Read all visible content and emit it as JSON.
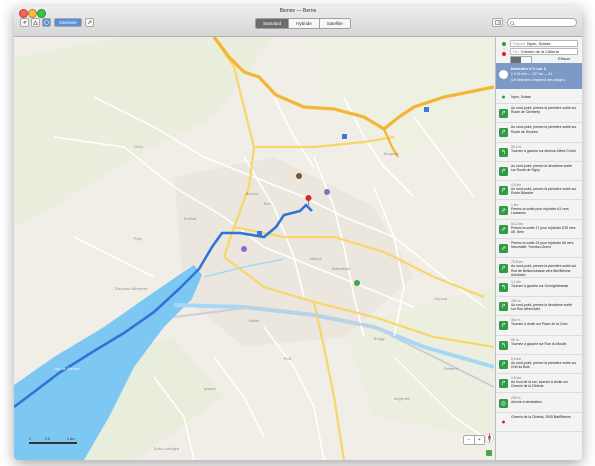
{
  "window": {
    "title": "Bienne — Berne"
  },
  "toolbar": {
    "itinerary_label": "Itinéraire",
    "map_modes": [
      "Standard",
      "Hybride",
      "Satellite"
    ],
    "selected_mode": "Standard"
  },
  "route": {
    "depart_label": "Départ",
    "depart_value": "Nyon, Suisse",
    "arrival_label": "Fin",
    "arrival_value": "Chemin de la Cibleria",
    "clear_label": "Effacer",
    "summary_title": "Itinéraire n°1 sur 2",
    "summary_detail": "1 h 49 min — 137 km — A1",
    "summary_note": "Cet itinéraire comprend des péages."
  },
  "steps": [
    {
      "icon": "pin-icon",
      "distance": "",
      "text": "Nyon, Suisse"
    },
    {
      "icon": "turn-right-icon",
      "distance": "",
      "text": "Au rond-point, prenez la première sortie sur Route de Clémenty"
    },
    {
      "icon": "turn-right-icon",
      "distance": "",
      "text": "Au rond-point, prenez la première sortie sur Route de Divonne"
    },
    {
      "icon": "turn-left-icon",
      "distance": "50,1 m",
      "text": "Tournez à gauche sur Avenue Alfred Cortot"
    },
    {
      "icon": "turn-right-icon",
      "distance": "",
      "text": "Au rond-point, prenez la deuxième sortie sur Route de Signy"
    },
    {
      "icon": "turn-right-icon",
      "distance": "0,6 km",
      "text": "Au rond-point, prenez la première sortie sur Route Blanche"
    },
    {
      "icon": "highway-icon",
      "distance": "1 km",
      "text": "Prenez la sortie pour rejoindre A1 vers Lausanne"
    },
    {
      "icon": "highway-icon",
      "distance": "53,2 km",
      "text": "Prenez la sortie 17 pour rejoindre E25 vers A9, Bern"
    },
    {
      "icon": "highway-icon",
      "distance": "",
      "text": "Prenez la sortie 24 pour rejoindre A5 vers Neuchâtel, Yverdon-Ouest"
    },
    {
      "icon": "turn-right-icon",
      "distance": "75,5 km",
      "text": "Au rond-point, prenez la première sortie sur Rue de Bellachstrasse vers Biel/Bienne, Autobahn"
    },
    {
      "icon": "turn-left-icon",
      "distance": "1,1 km",
      "text": "Tournez à gauche sur Gurnigelstrasse"
    },
    {
      "icon": "turn-right-icon",
      "distance": "254 m",
      "text": "Au rond-point, prenez la deuxième sortie sur Rue Alfred Aebi"
    },
    {
      "icon": "turn-right-icon",
      "distance": "464 m",
      "text": "Tournez à droite sur Place de la Croix"
    },
    {
      "icon": "turn-left-icon",
      "distance": "56 m",
      "text": "Tournez à gauche sur Rue du Moulin"
    },
    {
      "icon": "turn-right-icon",
      "distance": "0,6 km",
      "text": "Au rond-point, prenez la première sortie sur Crêt du Bois"
    },
    {
      "icon": "turn-right-icon",
      "distance": "0,6 km",
      "text": "Au bout de la rue, tournez à droite sur Chemin de la Cibleria"
    },
    {
      "icon": "destination-icon",
      "distance": "209 m",
      "text": "Arrivée à destination"
    },
    {
      "icon": "pin-icon",
      "distance": "",
      "text": "Chemin de la Cibleria, 2505 Biel/Bienne"
    }
  ],
  "map": {
    "labels": [
      "Orvin",
      "Evilard",
      "Bienne",
      "Biel",
      "Nidau",
      "Port",
      "Brügg",
      "Madretsch",
      "Mâche",
      "Boujean",
      "Péry",
      "Lac de Bienne",
      "Tüscherz-Alfermée",
      "Ipsach",
      "Sutz-Lattrigen",
      "Aegerten",
      "Orpund",
      "Safnern"
    ],
    "scale": [
      "0",
      "0,5",
      "1 km"
    ],
    "zoom_out": "−",
    "zoom_in": "+"
  },
  "colors": {
    "route": "#2f74d6",
    "water": "#7cc8f3",
    "green_sign": "#2f9b45",
    "summary_bg": "#7d99c6"
  }
}
